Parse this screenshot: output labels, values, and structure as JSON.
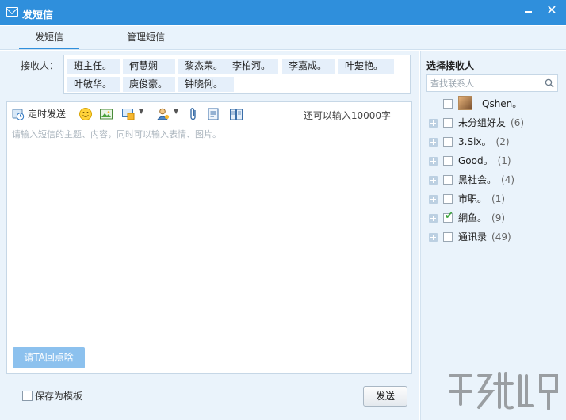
{
  "window": {
    "title": "发短信"
  },
  "tabs": [
    {
      "label": "发短信"
    },
    {
      "label": "管理短信"
    }
  ],
  "recipients": {
    "label": "接收人：",
    "chips": [
      "班主任。",
      "何慧娴",
      "黎杰荣。",
      "李柏河。",
      "李嘉成。",
      "叶楚艳。",
      "叶敏华。",
      "庾俊豪。",
      "钟晓俐。"
    ]
  },
  "toolbar": {
    "schedule_label": "定时发送",
    "counter": "还可以输入10000字",
    "icons": [
      "emoji-icon",
      "image-icon",
      "screenshot-icon",
      "contact-card-icon",
      "attachment-icon",
      "template-icon",
      "book-icon"
    ]
  },
  "compose": {
    "placeholder": "请输入短信的主题、内容，同时可以输入表情、图片。"
  },
  "reply_button": "请TA回点啥",
  "save_template": "保存为模板",
  "send_button": "发送",
  "contacts": {
    "title": "选择接收人",
    "search_placeholder": "查找联系人",
    "contact": {
      "name": "Qshen。"
    },
    "groups": [
      {
        "name": "未分组好友",
        "count": "(6)",
        "checked": false
      },
      {
        "name": "3.Six。",
        "count": "(2)",
        "checked": false
      },
      {
        "name": "Good。",
        "count": "(1)",
        "checked": false
      },
      {
        "name": "黑社会。",
        "count": "(4)",
        "checked": false
      },
      {
        "name": "市职。",
        "count": "(1)",
        "checked": false
      },
      {
        "name": "網鱼。",
        "count": "(9)",
        "checked": true
      },
      {
        "name": "通讯录",
        "count": "(49)",
        "checked": false
      }
    ]
  },
  "colors": {
    "titlebar": "#2f8fdc",
    "panel_bg": "#eaf3fb",
    "chip_bg": "#e5effa",
    "reply_button": "#8cc1ee"
  }
}
